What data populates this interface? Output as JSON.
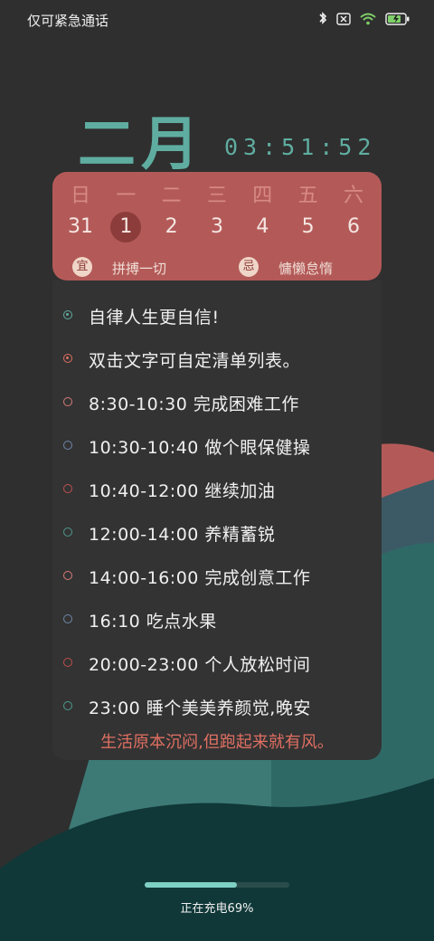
{
  "status_bar": {
    "carrier": "仅可紧急通话",
    "icons": [
      "bluetooth-icon",
      "sim-off-icon",
      "wifi-icon",
      "battery-charging-icon"
    ]
  },
  "header": {
    "month": "二月",
    "time": "03:51:52"
  },
  "calendar": {
    "weekdays": [
      "日",
      "一",
      "二",
      "三",
      "四",
      "五",
      "六"
    ],
    "dates": [
      "31",
      "1",
      "2",
      "3",
      "4",
      "5",
      "6"
    ],
    "today": "1",
    "yi_badge": "宜",
    "yi_text": "拼搏一切",
    "ji_badge": "忌",
    "ji_text": "慵懒怠惰"
  },
  "todo": {
    "items": [
      {
        "text": "自律人生更自信!",
        "dot_color": "#5fada0",
        "filled": true
      },
      {
        "text": "双击文字可自定清单列表。",
        "dot_color": "#e06f62",
        "filled": true
      },
      {
        "text": "8:30-10:30 完成困难工作",
        "dot_color": "#d97b78",
        "filled": false
      },
      {
        "text": "10:30-10:40 做个眼保健操",
        "dot_color": "#6e88a8",
        "filled": false
      },
      {
        "text": "10:40-12:00 继续加油",
        "dot_color": "#c0504e",
        "filled": false
      },
      {
        "text": "12:00-14:00 养精蓄锐",
        "dot_color": "#4f9a8e",
        "filled": false
      },
      {
        "text": "14:00-16:00 完成创意工作",
        "dot_color": "#d97b78",
        "filled": false
      },
      {
        "text": "16:10 吃点水果",
        "dot_color": "#6e88a8",
        "filled": false
      },
      {
        "text": "20:00-23:00 个人放松时间",
        "dot_color": "#c0504e",
        "filled": false
      },
      {
        "text": "23:00 睡个美美养颜觉,晚安",
        "dot_color": "#4f9a8e",
        "filled": false
      }
    ],
    "motto": "生活原本沉闷,但跑起来就有风。"
  },
  "charging": {
    "text": "正在充电69%",
    "percent": 69
  },
  "colors": {
    "accent": "#5fada0",
    "card": "#b35a58",
    "background": "#2f2f2f"
  }
}
